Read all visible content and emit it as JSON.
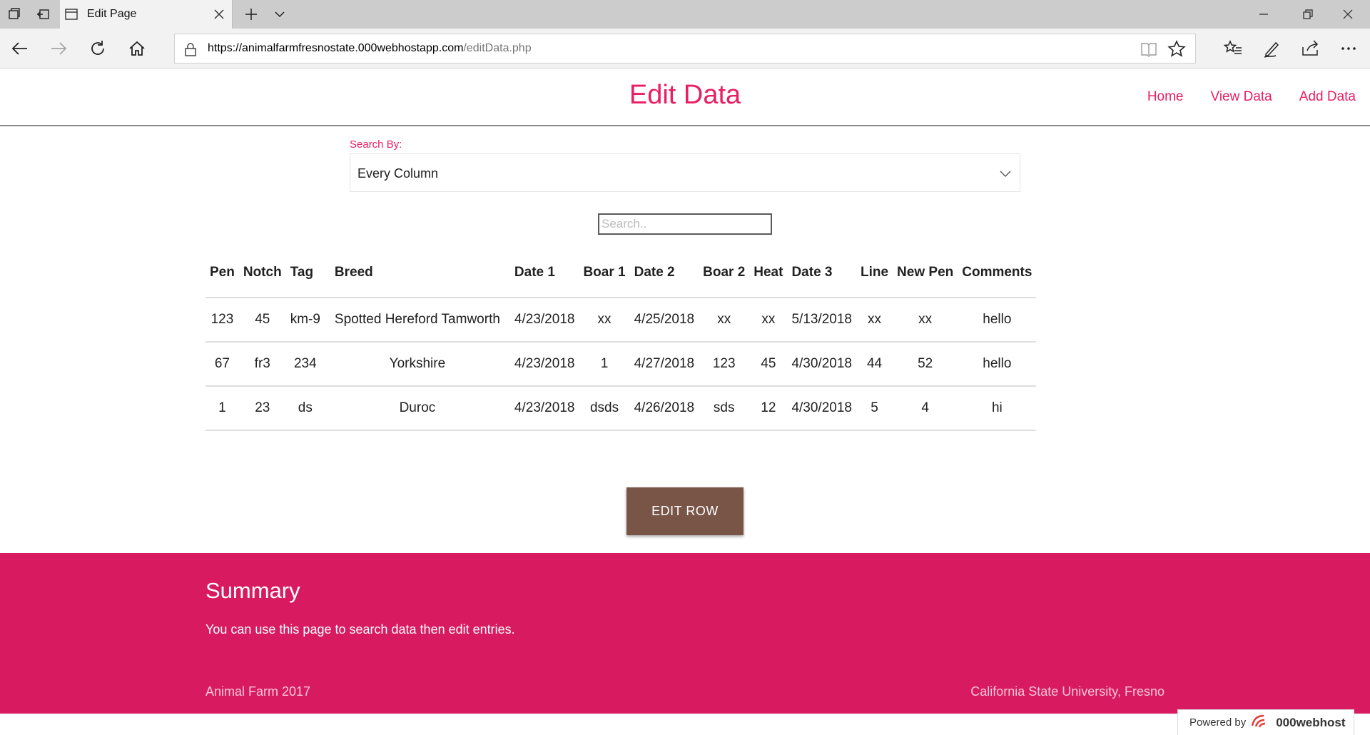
{
  "browser": {
    "tab_title": "Edit Page",
    "url_host": "https://animalfarmfresnostate.000webhostapp.com",
    "url_path": "/editData.php"
  },
  "header": {
    "title": "Edit Data",
    "nav": [
      "Home",
      "View Data",
      "Add Data"
    ]
  },
  "search": {
    "label": "Search By:",
    "selected_option": "Every Column",
    "placeholder": "Search.."
  },
  "table": {
    "columns": [
      "Pen",
      "Notch",
      "Tag",
      "Breed",
      "Date 1",
      "Boar 1",
      "Date 2",
      "Boar 2",
      "Heat",
      "Date 3",
      "Line",
      "New Pen",
      "Comments"
    ],
    "rows": [
      [
        "123",
        "45",
        "km-9",
        "Spotted Hereford Tamworth",
        "4/23/2018",
        "xx",
        "4/25/2018",
        "xx",
        "xx",
        "5/13/2018",
        "xx",
        "xx",
        "hello"
      ],
      [
        "67",
        "fr3",
        "234",
        "Yorkshire",
        "4/23/2018",
        "1",
        "4/27/2018",
        "123",
        "45",
        "4/30/2018",
        "44",
        "52",
        "hello"
      ],
      [
        "1",
        "23",
        "ds",
        "Duroc",
        "4/23/2018",
        "dsds",
        "4/26/2018",
        "sds",
        "12",
        "4/30/2018",
        "5",
        "4",
        "hi"
      ]
    ]
  },
  "edit_button_label": "EDIT ROW",
  "footer": {
    "heading": "Summary",
    "text": "You can use this page to search data then edit entries.",
    "left": "Animal Farm 2017",
    "right": "California State University, Fresno"
  },
  "powered_by": {
    "label": "Powered by",
    "brand": "000webhost"
  },
  "colors": {
    "accent": "#e91e63",
    "footer_bg": "#d81b60",
    "button_bg": "#795548"
  }
}
